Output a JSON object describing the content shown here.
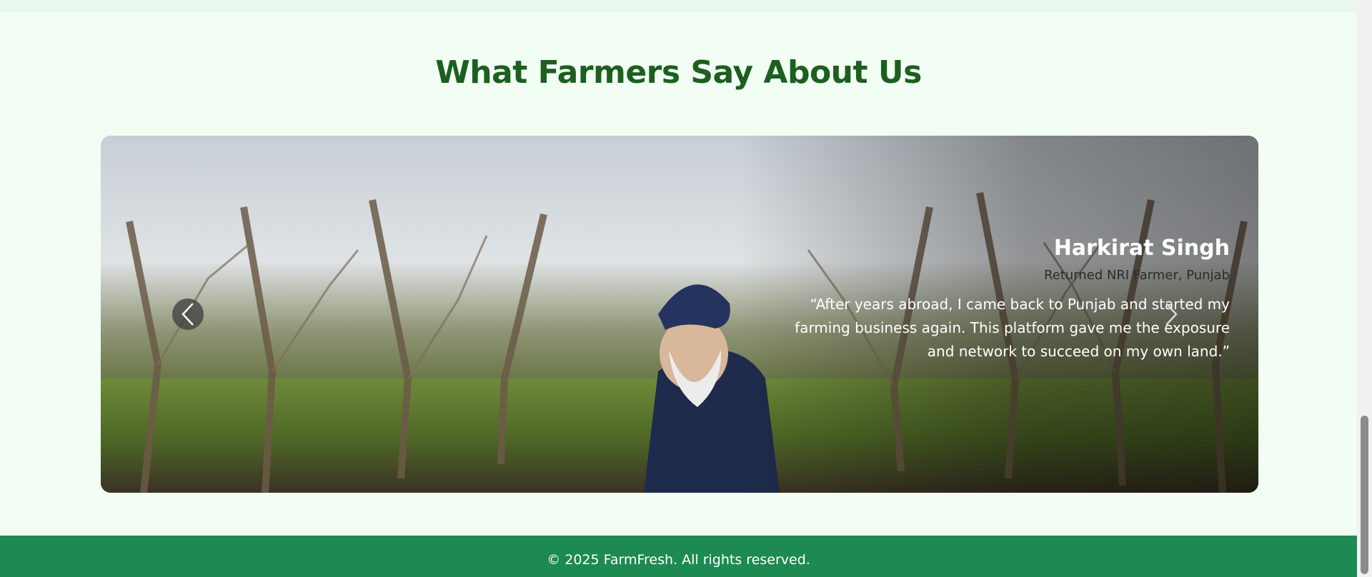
{
  "section": {
    "title": "What Farmers Say About Us"
  },
  "testimonial": {
    "name": "Harkirat Singh",
    "role": "Returned NRI Farmer, Punjab",
    "quote": "“After years abroad, I came back to Punjab and started my farming business again. This platform gave me the exposure and network to succeed on my own land.”",
    "image_icon": "farmer-photo"
  },
  "carousel": {
    "prev_icon": "chevron-left-icon",
    "next_icon": "chevron-right-icon"
  },
  "footer": {
    "text": "© 2025 FarmFresh. All rights reserved."
  },
  "colors": {
    "title": "#1c5f1f",
    "page_bg": "#f2fdf4",
    "footer_bg": "#1c8a52"
  }
}
